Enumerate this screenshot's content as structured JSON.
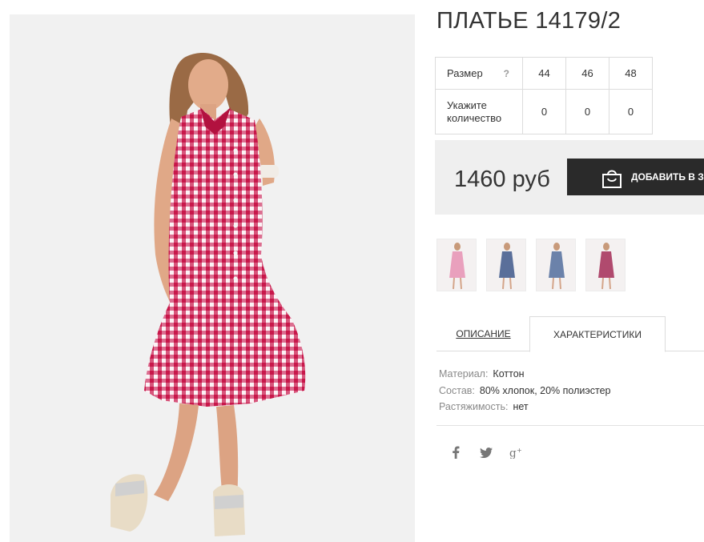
{
  "product": {
    "title": "ПЛАТЬЕ 14179/2",
    "main_image_alt": "dress-photo"
  },
  "size_table": {
    "size_label": "Размер",
    "help": "?",
    "sizes": [
      "44",
      "46",
      "48"
    ],
    "qty_label": "Укажите количество",
    "quantities": [
      "0",
      "0",
      "0"
    ]
  },
  "purchase": {
    "price": "1460 руб",
    "cart_button": "ДОБАВИТЬ В З"
  },
  "thumbnails": [
    {
      "color": "#e9a0bd"
    },
    {
      "color": "#5a6f9a"
    },
    {
      "color": "#6b82aa"
    },
    {
      "color": "#b04a6e"
    }
  ],
  "tabs": {
    "description": "ОПИСАНИЕ",
    "characteristics": "ХАРАКТЕРИСТИКИ"
  },
  "specs": {
    "material_label": "Материал:",
    "material_value": "Коттон",
    "composition_label": "Состав:",
    "composition_value": "80% хлопок, 20% полиэстер",
    "stretch_label": "Растяжимость:",
    "stretch_value": "нет"
  },
  "social": [
    "facebook-icon",
    "twitter-icon",
    "google-plus-icon"
  ],
  "colors": {
    "dress": "#c8174a",
    "button": "#2a2a2a",
    "price_bg": "#efefef"
  }
}
